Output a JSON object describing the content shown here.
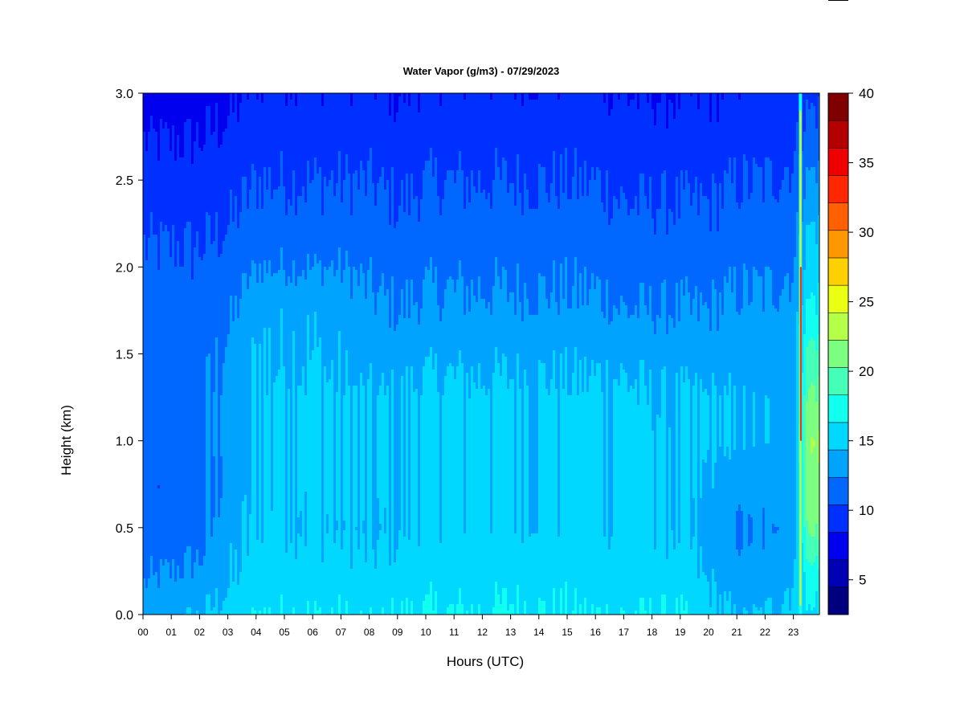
{
  "chart_data": {
    "type": "heatmap",
    "title": "Water Vapor (g/m3) - 07/29/2023",
    "xlabel": "Hours (UTC)",
    "ylabel": "Height (km)",
    "xlim": [
      0,
      24
    ],
    "ylim": [
      0.0,
      3.0
    ],
    "x_ticks": [
      "00",
      "01",
      "02",
      "03",
      "04",
      "05",
      "06",
      "07",
      "08",
      "09",
      "10",
      "11",
      "12",
      "13",
      "14",
      "15",
      "16",
      "17",
      "18",
      "19",
      "20",
      "21",
      "22",
      "23"
    ],
    "y_ticks": [
      "0.0",
      "0.5",
      "1.0",
      "1.5",
      "2.0",
      "2.5",
      "3.0"
    ],
    "colorbar": {
      "range": [
        2.5,
        40
      ],
      "levels": [
        2.5,
        5,
        7.5,
        10,
        12.5,
        15,
        17.5,
        20,
        22.5,
        25,
        27.5,
        30,
        32.5,
        35,
        37.5,
        40
      ],
      "tick_labels": [
        "5",
        "10",
        "15",
        "20",
        "25",
        "30",
        "35",
        "40"
      ],
      "tick_values": [
        5,
        10,
        15,
        20,
        25,
        30,
        35,
        40
      ],
      "colors": [
        "#00007F",
        "#0000B4",
        "#0000EE",
        "#0030FF",
        "#0068FF",
        "#00A4FF",
        "#00D8FF",
        "#10FFEE",
        "#45FFB8",
        "#7CFF80",
        "#B5FF48",
        "#EAFF12",
        "#FFD000",
        "#FF9800",
        "#FF6000",
        "#FF2800",
        "#EE0000",
        "#B40000",
        "#7F0000"
      ],
      "band_colors": [
        "#00007F",
        "#0000B4",
        "#0000EE",
        "#0030FF",
        "#0068FF",
        "#00A4FF",
        "#00D8FF",
        "#10FFEE",
        "#45FFB8",
        "#7CFF80",
        "#B5FF48",
        "#EAFF12",
        "#FFD000",
        "#FF9800",
        "#FF6000",
        "#FF2800",
        "#EE0000",
        "#B40000",
        "#7F0000"
      ]
    },
    "height_km": [
      0.0,
      0.25,
      0.5,
      0.75,
      1.0,
      1.25,
      1.5,
      1.75,
      2.0,
      2.25,
      2.5,
      2.75,
      3.0
    ],
    "hours": [
      0,
      1,
      2,
      3,
      4,
      5,
      6,
      7,
      8,
      9,
      10,
      11,
      12,
      13,
      14,
      15,
      16,
      17,
      18,
      19,
      20,
      21,
      22,
      23,
      23.5
    ],
    "vapor": [
      [
        14,
        12,
        11,
        10.5,
        11,
        11.5,
        11.5,
        11,
        10.5,
        9.5,
        8.5,
        7.5,
        6
      ],
      [
        14.5,
        12.5,
        11,
        10.5,
        11,
        11.5,
        11.5,
        11,
        10.5,
        9.5,
        8.5,
        7.5,
        6
      ],
      [
        15,
        13,
        11.5,
        11.5,
        12,
        12,
        11.5,
        11,
        10.5,
        9.5,
        8.5,
        7.5,
        6.5
      ],
      [
        16,
        14.5,
        14,
        13.5,
        13.5,
        13.5,
        13,
        12,
        11,
        10,
        9,
        8,
        7
      ],
      [
        17.5,
        16,
        15.5,
        15,
        15,
        15,
        15,
        14.5,
        12.5,
        11,
        10,
        9,
        8
      ],
      [
        17.5,
        16,
        15.5,
        15.5,
        15.5,
        15.5,
        15,
        14.5,
        12.5,
        11,
        10,
        9,
        8
      ],
      [
        17.5,
        16,
        15,
        15.5,
        15.5,
        15.5,
        15,
        14.5,
        12.5,
        11,
        10,
        9,
        8
      ],
      [
        17.5,
        16,
        15,
        15,
        15,
        15,
        14.5,
        14,
        12.5,
        11,
        10,
        9,
        8
      ],
      [
        17,
        15.5,
        14.5,
        15,
        15,
        15,
        14,
        13,
        12,
        11,
        10,
        9,
        8
      ],
      [
        17.5,
        16,
        15,
        15,
        15,
        15,
        14,
        12.5,
        11.5,
        10.5,
        9.5,
        8.5,
        7.5
      ],
      [
        17.5,
        16.5,
        15.5,
        15.5,
        15.5,
        15.5,
        14.5,
        13,
        12,
        11,
        10,
        9,
        8
      ],
      [
        17.5,
        16.5,
        15.5,
        15.5,
        15.5,
        15.5,
        14.5,
        13,
        12,
        11,
        10,
        9,
        8
      ],
      [
        17.5,
        16.5,
        15.5,
        15.5,
        15.5,
        15.5,
        14.5,
        13,
        12,
        11,
        10,
        9,
        8
      ],
      [
        18,
        16.5,
        15.5,
        15.5,
        15.5,
        15.5,
        14.5,
        13,
        12,
        11,
        10,
        9,
        8
      ],
      [
        17.5,
        16.5,
        15.5,
        15.5,
        15.5,
        15.5,
        14.5,
        13,
        12,
        11,
        10,
        9,
        8
      ],
      [
        17.5,
        16.5,
        15.5,
        15.5,
        15.5,
        15.5,
        14.5,
        13,
        12,
        11,
        10,
        9,
        8
      ],
      [
        17.5,
        16,
        15.5,
        15.5,
        15.5,
        15.5,
        14.5,
        13,
        12,
        11,
        10,
        9,
        8
      ],
      [
        17.5,
        16,
        15.5,
        15.5,
        15.5,
        15.5,
        14.5,
        12.5,
        11.5,
        10.5,
        9.5,
        8.5,
        7.5
      ],
      [
        17.5,
        16,
        15.5,
        15.5,
        15.5,
        15,
        14,
        12.5,
        11.5,
        10.5,
        9.5,
        8.5,
        7.5
      ],
      [
        17.5,
        16,
        15,
        15,
        15,
        15,
        14,
        12.5,
        11.5,
        10.5,
        9.5,
        8.5,
        7.5
      ],
      [
        16,
        14.5,
        14,
        14.5,
        15,
        15,
        14,
        12.5,
        11.5,
        10.5,
        9.5,
        8.5,
        7.5
      ],
      [
        14.5,
        13.5,
        12.5,
        13.5,
        14.5,
        14.5,
        14,
        13,
        12,
        11,
        10,
        9,
        8
      ],
      [
        15,
        13.5,
        12.5,
        13.5,
        14.5,
        14.5,
        14,
        13,
        12,
        11,
        10,
        9,
        8
      ],
      [
        16,
        15,
        14,
        14,
        14.5,
        14.5,
        14,
        13.5,
        12.5,
        11.5,
        10.5,
        9.5,
        8.5
      ],
      [
        17,
        19,
        23,
        24,
        25,
        23,
        21,
        18,
        16.5,
        15,
        13,
        11,
        9.5
      ]
    ],
    "spike": {
      "hour": 23.25,
      "value": 38
    }
  }
}
